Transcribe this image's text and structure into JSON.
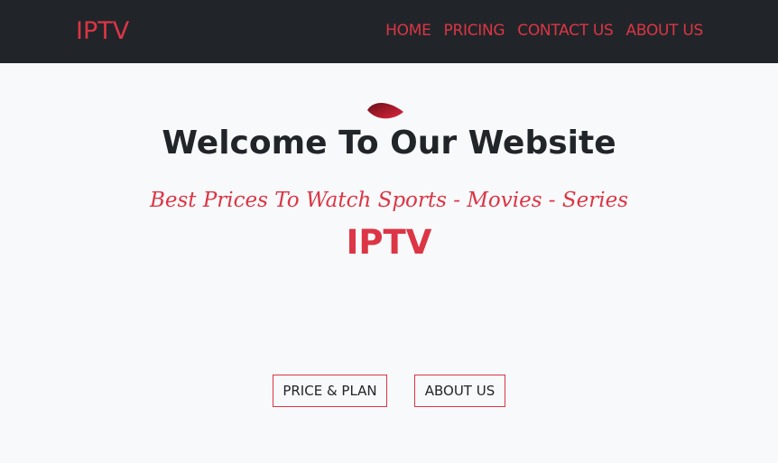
{
  "navbar": {
    "brand": "IPTV",
    "links": [
      {
        "label": "HOME"
      },
      {
        "label": "PRICING"
      },
      {
        "label": "CONTACT US"
      },
      {
        "label": "ABOUT US"
      }
    ]
  },
  "hero": {
    "title": "Welcome To Our Website",
    "subtitle": "Best Prices To Watch Sports - Movies - Series",
    "brand": "IPTV",
    "buttons": {
      "price_label": "PRICE & PLAN",
      "about_label": "ABOUT US"
    },
    "icon": "leaf-icon"
  },
  "colors": {
    "accent": "#dc3545",
    "nav_bg": "#212529",
    "page_bg": "#f8f9fa",
    "text_dark": "#212529"
  }
}
